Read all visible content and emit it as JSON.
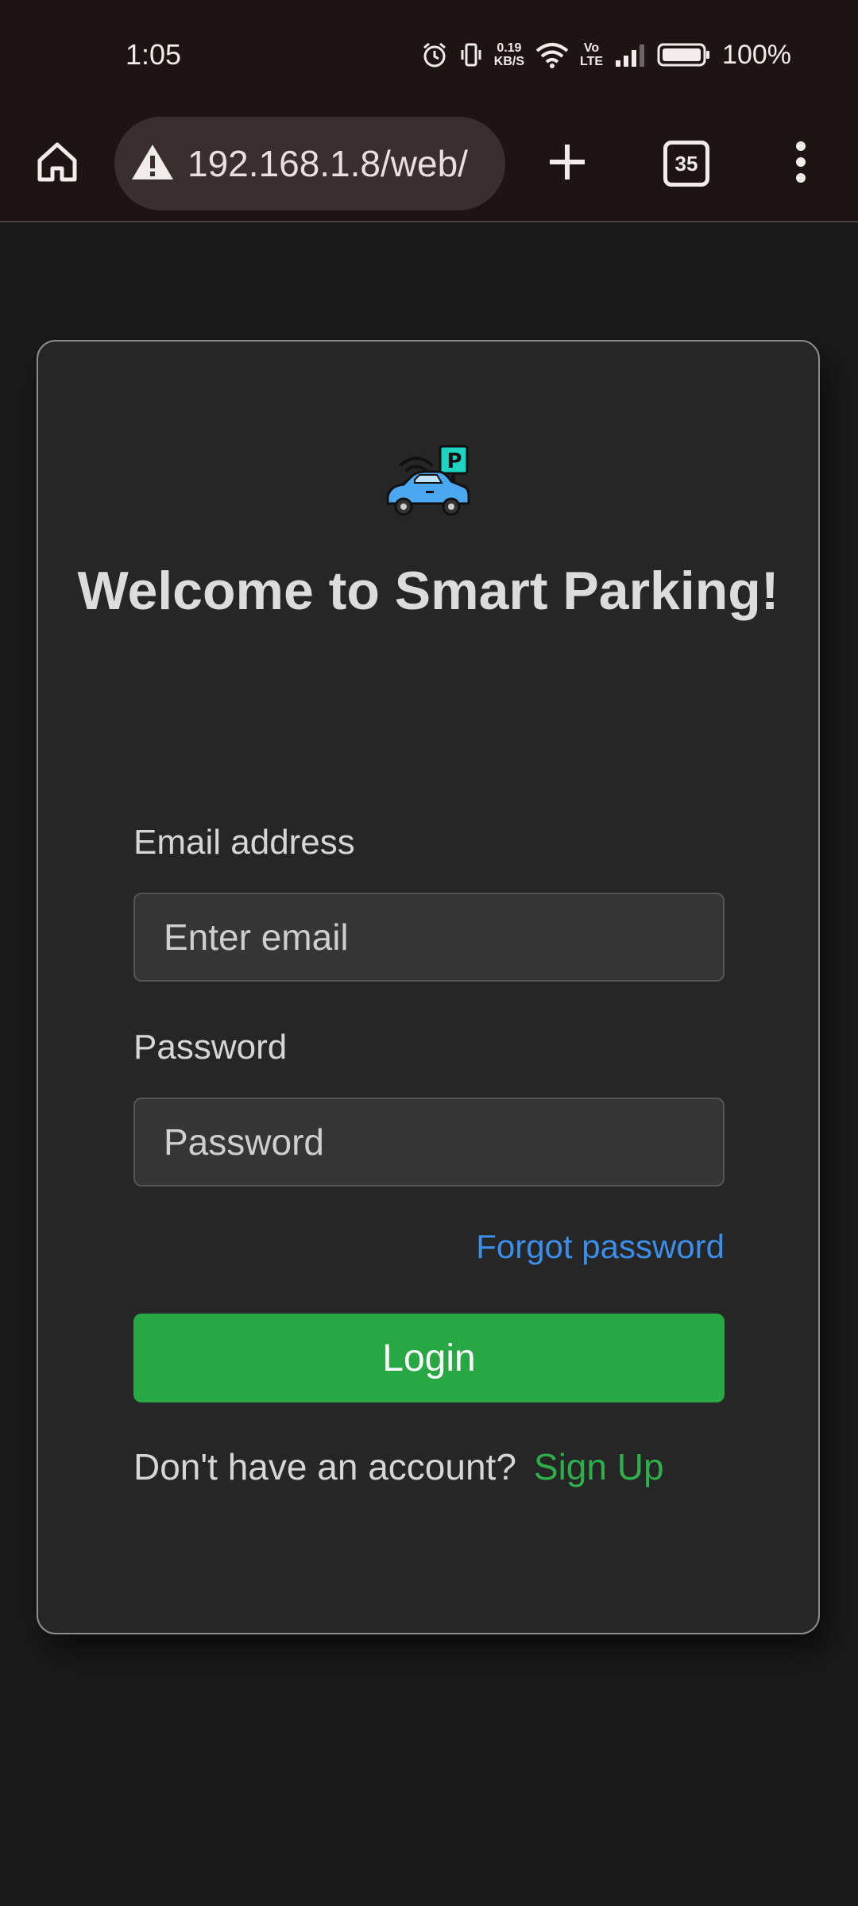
{
  "status_bar": {
    "time": "1:05",
    "net_speed_value": "0.19",
    "net_speed_unit": "KB/S",
    "volte_top": "Vo",
    "volte_bottom": "LTE",
    "battery_percent": "100%"
  },
  "browser": {
    "url": "192.168.1.8/web/",
    "tab_count": "35"
  },
  "login": {
    "title": "Welcome to Smart Parking!",
    "email_label": "Email address",
    "email_placeholder": "Enter email",
    "email_value": "",
    "password_label": "Password",
    "password_placeholder": "Password",
    "password_value": "",
    "forgot_link": "Forgot password",
    "login_button": "Login",
    "no_account_text": "Don't have an account?",
    "signup_link": "Sign Up"
  },
  "logo": {
    "sign_letter": "P"
  },
  "colors": {
    "accent_green": "#28a745",
    "link_blue": "#3b8eea",
    "card_background": "#262626",
    "page_background": "#1a1a1a"
  }
}
